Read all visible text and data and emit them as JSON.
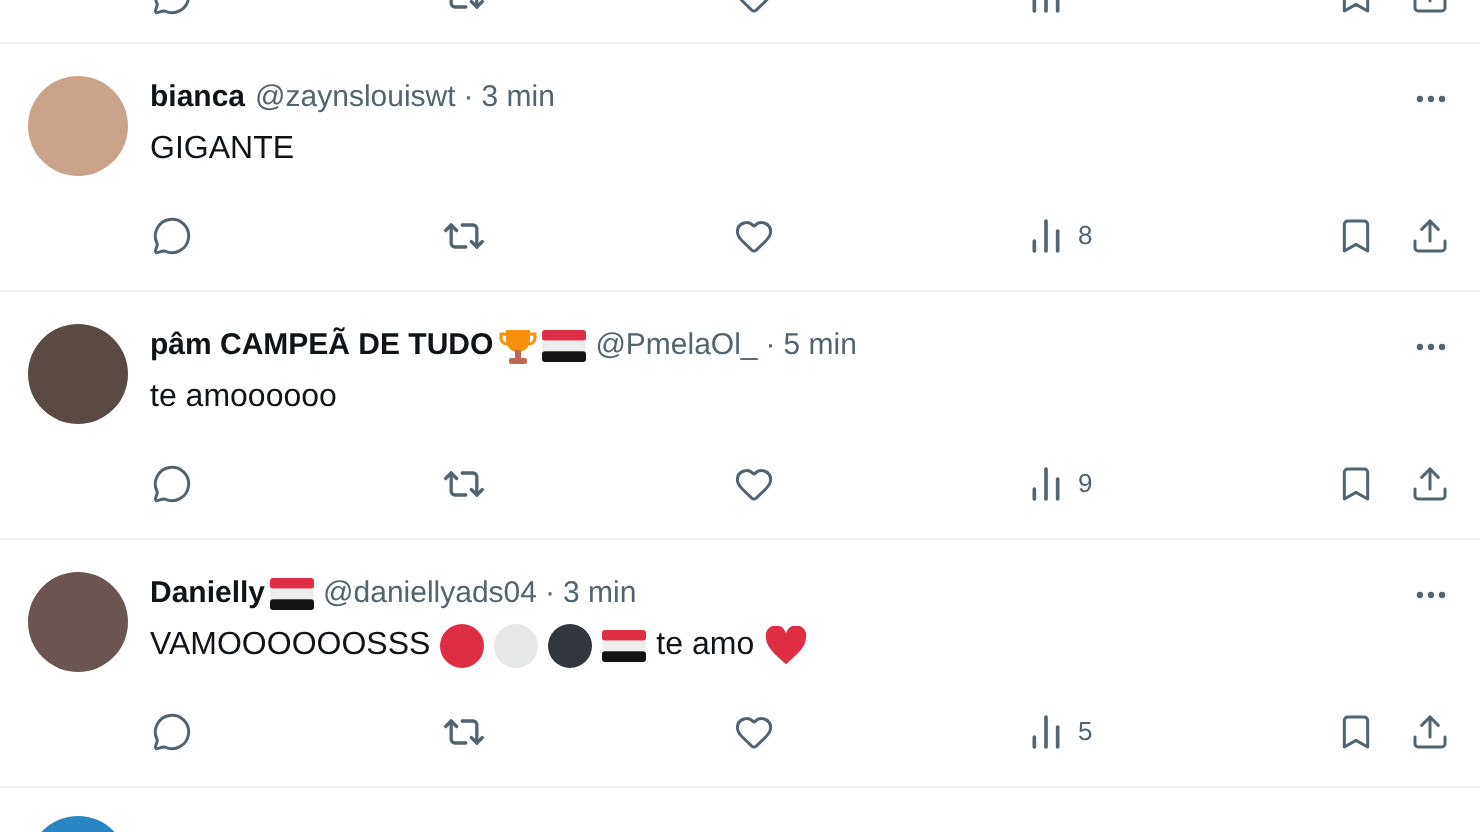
{
  "posts": [
    {
      "name": [
        {
          "kind": "text",
          "text": "bianca"
        }
      ],
      "handle": "@zaynslouiswt",
      "separator": "·",
      "time": "3 min",
      "body": [
        {
          "kind": "text",
          "text": "GIGANTE"
        }
      ],
      "views": "8"
    },
    {
      "name": [
        {
          "kind": "text",
          "text": "pâm CAMPEÃ DE TUDO"
        },
        {
          "kind": "trophy"
        },
        {
          "kind": "flag"
        }
      ],
      "handle": "@PmelaOl_",
      "separator": "·",
      "time": "5 min",
      "body": [
        {
          "kind": "text",
          "text": "te amoooooo"
        }
      ],
      "views": "9"
    },
    {
      "name": [
        {
          "kind": "text",
          "text": "Danielly"
        },
        {
          "kind": "flag"
        }
      ],
      "handle": "@daniellyads04",
      "separator": "·",
      "time": "3 min",
      "body": [
        {
          "kind": "text",
          "text": "VAMOOOOOOSSS"
        },
        {
          "kind": "circle",
          "color": "#dd2e44"
        },
        {
          "kind": "circle",
          "color": "#e6e7e8"
        },
        {
          "kind": "circle",
          "color": "#31373d"
        },
        {
          "kind": "flag"
        },
        {
          "kind": "text",
          "text": "te amo"
        },
        {
          "kind": "heart"
        }
      ],
      "views": "5"
    }
  ]
}
